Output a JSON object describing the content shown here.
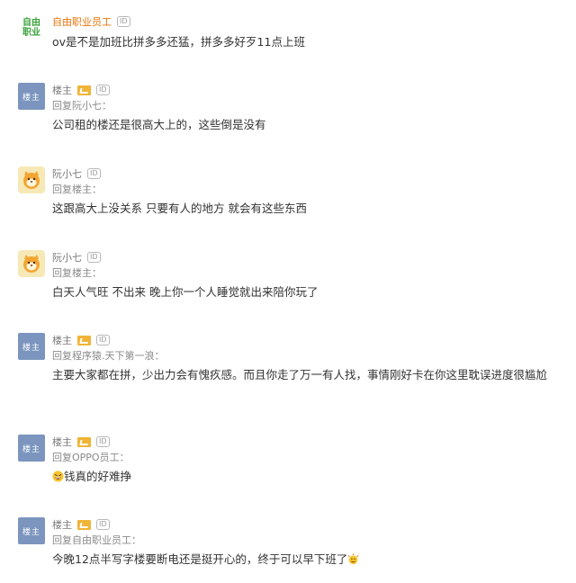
{
  "comments": [
    {
      "avatar_text": "自由职业",
      "user": "自由职业员工",
      "content": "ov是不是加班比拼多多还猛，拼多多好歹11点上班"
    },
    {
      "avatar_text": "楼主",
      "user": "楼主",
      "reply": "回复阮小七：",
      "content": "公司租的楼还是很高大上的，这些倒是没有"
    },
    {
      "user": "阮小七",
      "reply": "回复楼主：",
      "content": "这跟高大上没关系 只要有人的地方 就会有这些东西"
    },
    {
      "user": "阮小七",
      "reply": "回复楼主：",
      "content": "白天人气旺 不出来 晚上你一个人睡觉就出来陪你玩了"
    },
    {
      "avatar_text": "楼主",
      "user": "楼主",
      "reply": "回复程序猿.天下第一浪：",
      "content": "主要大家都在拼，少出力会有愧疚感。而且你走了万一有人找，事情刚好卡在你这里耽误进度很尴尬"
    },
    {
      "avatar_text": "楼主",
      "user": "楼主",
      "reply": "回复OPPO员工：",
      "content": "钱真的好难挣"
    },
    {
      "avatar_text": "楼主",
      "user": "楼主",
      "reply": "回复自由职业员工：",
      "content": "今晚12点半写字楼要断电还是挺开心的，终于可以早下班了"
    }
  ],
  "badges": {
    "id": "ID"
  },
  "icons": {
    "vip": "vip-badge-icon",
    "cat_avatar": "cat-face-icon",
    "grin_emoji": "grinning-face-emoji",
    "celebrate_emoji": "celebration-emoji"
  },
  "colors": {
    "brand_green": "#3aa33a",
    "username_orange": "#e8760a",
    "host_avatar": "#7b95bf",
    "vip_gold": "#f0b437"
  }
}
